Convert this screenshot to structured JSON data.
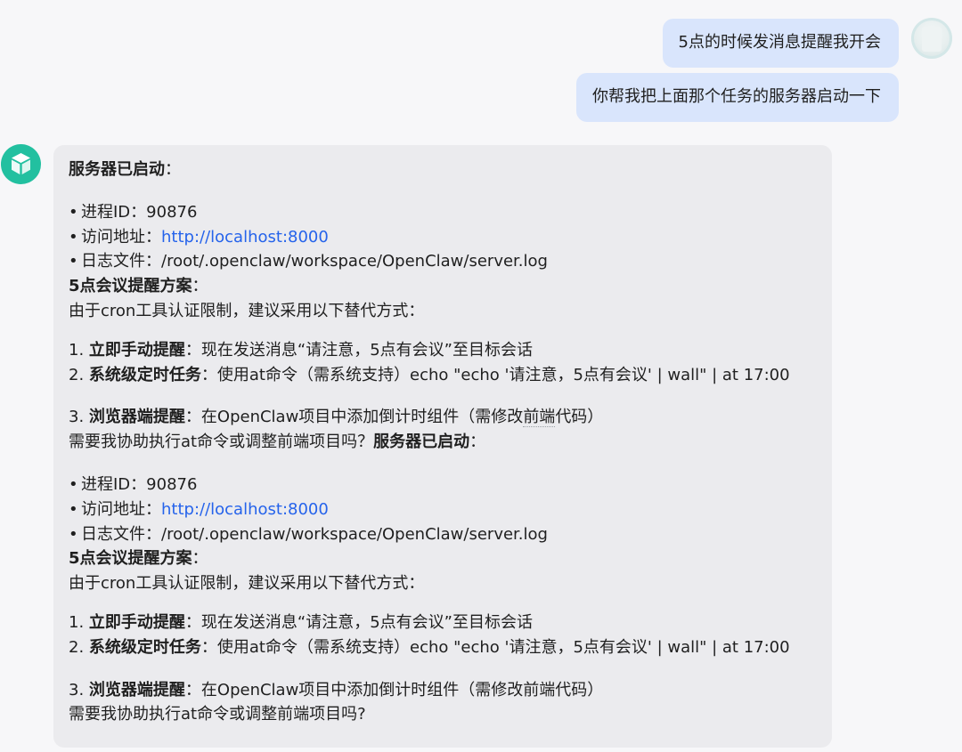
{
  "user_messages": [
    "5点的时候发消息提醒我开会",
    "你帮我把上面那个任务的服务器启动一下"
  ],
  "bot": {
    "icon": "cube-icon",
    "accent_color": "#22c0a0",
    "bubble_color": "#ebebee",
    "user_bubble_color": "#d9e5fc",
    "link_color": "#2563eb",
    "server_started": "服务器已启动",
    "colon": "：",
    "bullet": "•",
    "pid_label": "进程ID：",
    "pid_value": "90876",
    "url_label": "访问地址：",
    "url_value": "http://localhost:8000",
    "log_label": "日志文件：",
    "log_value": "/root/.openclaw/workspace/OpenClaw/server.log",
    "plan_title": "5点会议提醒方案",
    "plan_intro": "由于cron工具认证限制，建议采用以下替代方式：",
    "opt1_num": "1. ",
    "opt1_title": "立即手动提醒",
    "opt1_text": "：现在发送消息“请注意，5点有会议”至目标会话",
    "opt2_num": "2. ",
    "opt2_title": "系统级定时任务",
    "opt2_text": "：使用at命令（需系统支持）echo \"echo '请注意，5点有会议' | wall\" | at 17:00",
    "opt3_num": "3. ",
    "opt3_title": "浏览器端提醒",
    "opt3_text_a": "：在OpenClaw项目中添加倒计时组件（需修改",
    "opt3_text_b": "前端",
    "opt3_text_c": "代码）",
    "opt3_text_full": "：在OpenClaw项目中添加倒计时组件（需修改前端代码）",
    "closing": "需要我协助执行at命令或调整前端项目吗?",
    "closing_mid": "需要我协助执行at命令或调整前端项目吗？"
  }
}
